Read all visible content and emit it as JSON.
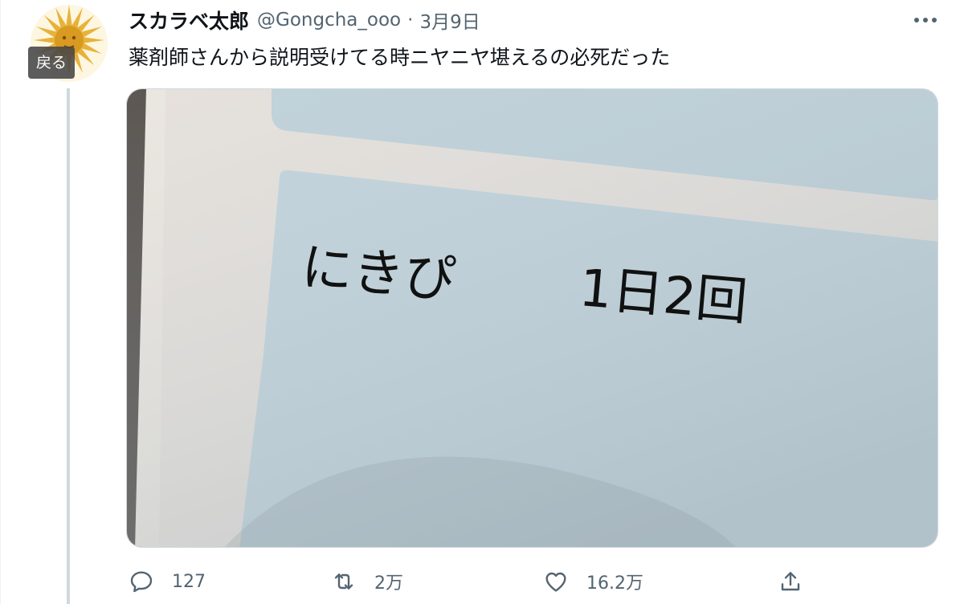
{
  "user": {
    "display_name": "スカラベ太郎",
    "handle": "@Gongcha_ooo",
    "date": "3月9日",
    "avatar_badge": "戻る"
  },
  "tweet": {
    "text": "薬剤師さんから説明受けてる時ニヤニヤ堪えるの必死だった"
  },
  "media": {
    "label_name": "にきぴ",
    "label_dose": "1日2回"
  },
  "actions": {
    "reply_count": "127",
    "retweet_count": "2万",
    "like_count": "16.2万"
  },
  "icons": {
    "more": "more-icon",
    "reply": "reply-icon",
    "retweet": "retweet-icon",
    "like": "like-icon",
    "share": "share-icon"
  },
  "colors": {
    "text_primary": "#0f1419",
    "text_secondary": "#536471",
    "thread_line": "#cfd9de"
  }
}
